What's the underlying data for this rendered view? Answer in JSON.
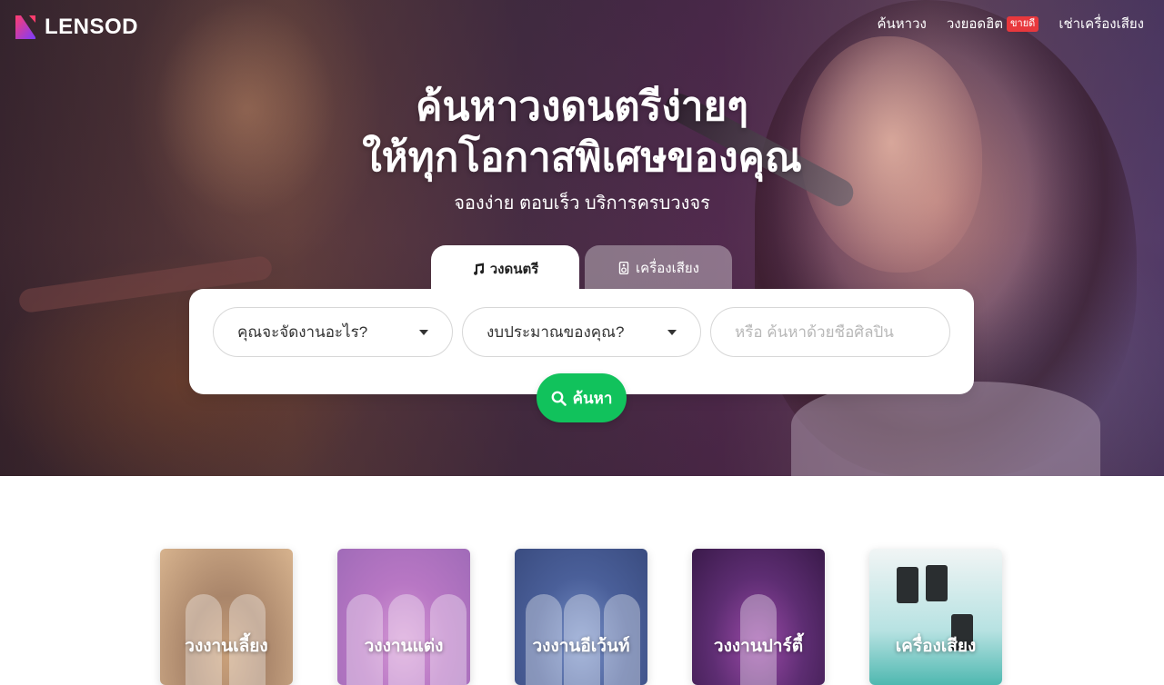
{
  "brand": {
    "name": "LENSOD"
  },
  "nav": {
    "items": [
      {
        "label": "ค้นหาวง"
      },
      {
        "label": "วงยอดฮิต",
        "badge": "ขายดี"
      },
      {
        "label": "เช่าเครื่องเสียง"
      }
    ]
  },
  "hero": {
    "title_line1": "ค้นหาวงดนตรีง่ายๆ",
    "title_line2": "ให้ทุกโอกาสพิเศษของคุณ",
    "subtitle": "จองง่าย ตอบเร็ว บริการครบวงจร"
  },
  "tabs": [
    {
      "label": "วงดนตรี",
      "icon": "music-note-icon",
      "active": true
    },
    {
      "label": "เครื่องเสียง",
      "icon": "speaker-icon",
      "active": false
    }
  ],
  "search": {
    "event_select": "คุณจะจัดงานอะไร?",
    "budget_select": "งบประมาณของคุณ?",
    "artist_placeholder": "หรือ ค้นหาด้วยชื่อศิลปิน",
    "button_label": "ค้นหา"
  },
  "categories": [
    {
      "label": "วงงานเลี้ยง"
    },
    {
      "label": "วงงานแต่ง"
    },
    {
      "label": "วงงานอีเว้นท์"
    },
    {
      "label": "วงงานปาร์ตี้"
    },
    {
      "label": "เครื่องเสียง"
    }
  ],
  "colors": {
    "accent_green": "#11c25c",
    "badge_red": "#e8383d",
    "logo_gradient": [
      "#ff3d6e",
      "#7b3cff"
    ]
  }
}
